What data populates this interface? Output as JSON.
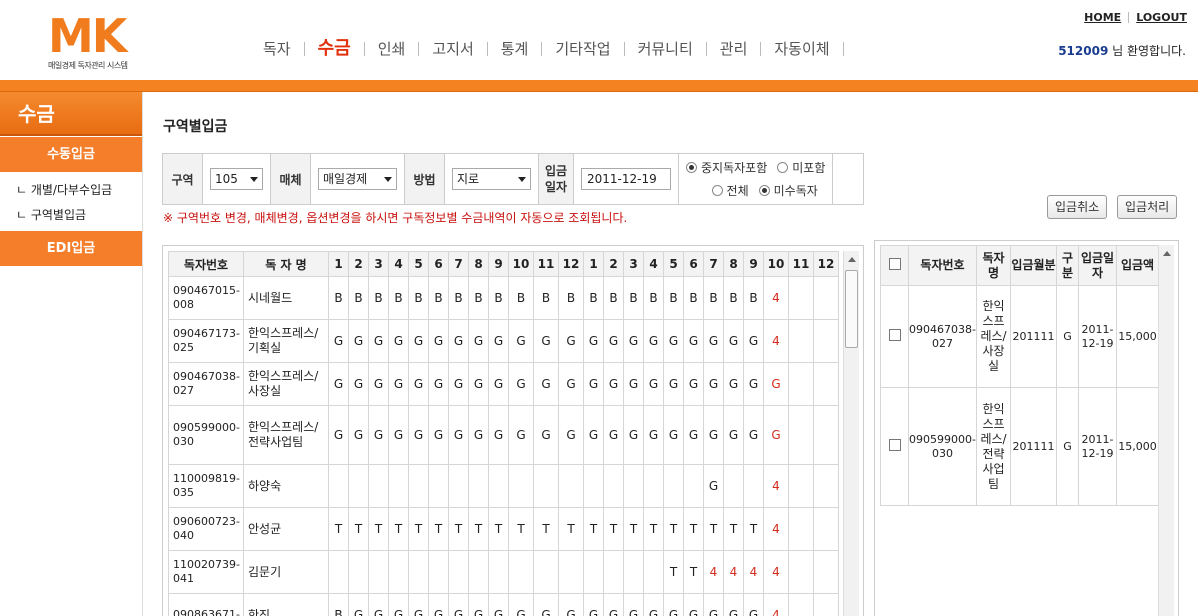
{
  "header": {
    "logo_text": "MK",
    "logo_sub": "매일경제 독자관리 시스템",
    "nav": [
      "독자",
      "수금",
      "인쇄",
      "고지서",
      "통계",
      "기타작업",
      "커뮤니티",
      "관리",
      "자동이체"
    ],
    "active_nav": "수금",
    "home": "HOME",
    "logout": "LOGOUT",
    "user_id": "512009",
    "welcome_suffix": " 님  환영합니다."
  },
  "sidebar": {
    "title": "수금",
    "menu1": "수동입금",
    "sub1": "ㄴ 개별/다부수입금",
    "sub2": "ㄴ 구역별입금",
    "menu2": "EDI입금"
  },
  "page": {
    "title": "구역별입금"
  },
  "search": {
    "area_label": "구역",
    "area_value": "105",
    "media_label": "매체",
    "media_value": "매일경제",
    "method_label": "방법",
    "method_value": "지로",
    "date_label": "입금일자",
    "date_value": "2011-12-19",
    "radio1a": "중지독자포함",
    "radio1b": "미포함",
    "radio2a": "전체",
    "radio2b": "미수독자",
    "notice": "※ 구역번호 변경, 매체변경, 옵션변경을 하시면 구독정보별 수금내역이 자동으로 조회됩니다."
  },
  "buttons": {
    "cancel": "입금취소",
    "process": "입금처리"
  },
  "left_table": {
    "headers": [
      "독자번호",
      "독 자 명",
      "1",
      "2",
      "3",
      "4",
      "5",
      "6",
      "7",
      "8",
      "9",
      "10",
      "11",
      "12",
      "1",
      "2",
      "3",
      "4",
      "5",
      "6",
      "7",
      "8",
      "9",
      "10",
      "11",
      "12"
    ],
    "rows": [
      {
        "no1": "090467015-",
        "no2": "008",
        "name": "시네월드",
        "cells": [
          "B",
          "B",
          "B",
          "B",
          "B",
          "B",
          "B",
          "B",
          "B",
          "B",
          "B",
          "B",
          "B",
          "B",
          "B",
          "B",
          "B",
          "B",
          "B",
          "B",
          "B",
          "4",
          "",
          ""
        ]
      },
      {
        "no1": "090467173-",
        "no2": "025",
        "name": "한익스프레스/ 기획실",
        "cells": [
          "G",
          "G",
          "G",
          "G",
          "G",
          "G",
          "G",
          "G",
          "G",
          "G",
          "G",
          "G",
          "G",
          "G",
          "G",
          "G",
          "G",
          "G",
          "G",
          "G",
          "G",
          "4",
          "",
          ""
        ]
      },
      {
        "no1": "090467038-",
        "no2": "027",
        "name": "한익스프레스/사장실",
        "cells": [
          "G",
          "G",
          "G",
          "G",
          "G",
          "G",
          "G",
          "G",
          "G",
          "G",
          "G",
          "G",
          "G",
          "G",
          "G",
          "G",
          "G",
          "G",
          "G",
          "G",
          "G",
          "G",
          "",
          ""
        ]
      },
      {
        "no1": "090599000-",
        "no2": "030",
        "name": "한익스프레스/전략사업팀",
        "cells": [
          "G",
          "G",
          "G",
          "G",
          "G",
          "G",
          "G",
          "G",
          "G",
          "G",
          "G",
          "G",
          "G",
          "G",
          "G",
          "G",
          "G",
          "G",
          "G",
          "G",
          "G",
          "G",
          "",
          ""
        ]
      },
      {
        "no1": "110009819-",
        "no2": "035",
        "name": "하양숙",
        "cells": [
          "",
          "",
          "",
          "",
          "",
          "",
          "",
          "",
          "",
          "",
          "",
          "",
          "",
          "",
          "",
          "",
          "",
          "",
          "G",
          "",
          "",
          "4",
          "",
          ""
        ]
      },
      {
        "no1": "090600723-",
        "no2": "040",
        "name": "안성균",
        "cells": [
          "T",
          "T",
          "T",
          "T",
          "T",
          "T",
          "T",
          "T",
          "T",
          "T",
          "T",
          "T",
          "T",
          "T",
          "T",
          "T",
          "T",
          "T",
          "T",
          "T",
          "T",
          "4",
          "",
          ""
        ]
      },
      {
        "no1": "110020739-",
        "no2": "041",
        "name": "김문기",
        "cells": [
          "",
          "",
          "",
          "",
          "",
          "",
          "",
          "",
          "",
          "",
          "",
          "",
          "",
          "",
          "",
          "",
          "T",
          "T",
          "4",
          "4",
          "4",
          "4",
          "",
          ""
        ]
      },
      {
        "no1": "090863671-",
        "no2": "",
        "name": "한진",
        "cells": [
          "B",
          "G",
          "G",
          "G",
          "G",
          "G",
          "G",
          "G",
          "G",
          "G",
          "G",
          "G",
          "G",
          "G",
          "G",
          "G",
          "G",
          "G",
          "G",
          "G",
          "G",
          "4",
          "",
          ""
        ]
      }
    ]
  },
  "right_table": {
    "headers": [
      "독자번호",
      "독자명",
      "입금월분",
      "구분",
      "입금일자",
      "입금액"
    ],
    "rows": [
      {
        "no1": "090467038-",
        "no2": "027",
        "name": "한익스프레스/사장실",
        "month": "201111",
        "kind": "G",
        "date1": "2011-",
        "date2": "12-19",
        "amount": "15,000"
      },
      {
        "no1": "090599000-",
        "no2": "030",
        "name": "한익스프레스/전략사업팀",
        "month": "201111",
        "kind": "G",
        "date1": "2011-",
        "date2": "12-19",
        "amount": "15,000"
      }
    ]
  }
}
